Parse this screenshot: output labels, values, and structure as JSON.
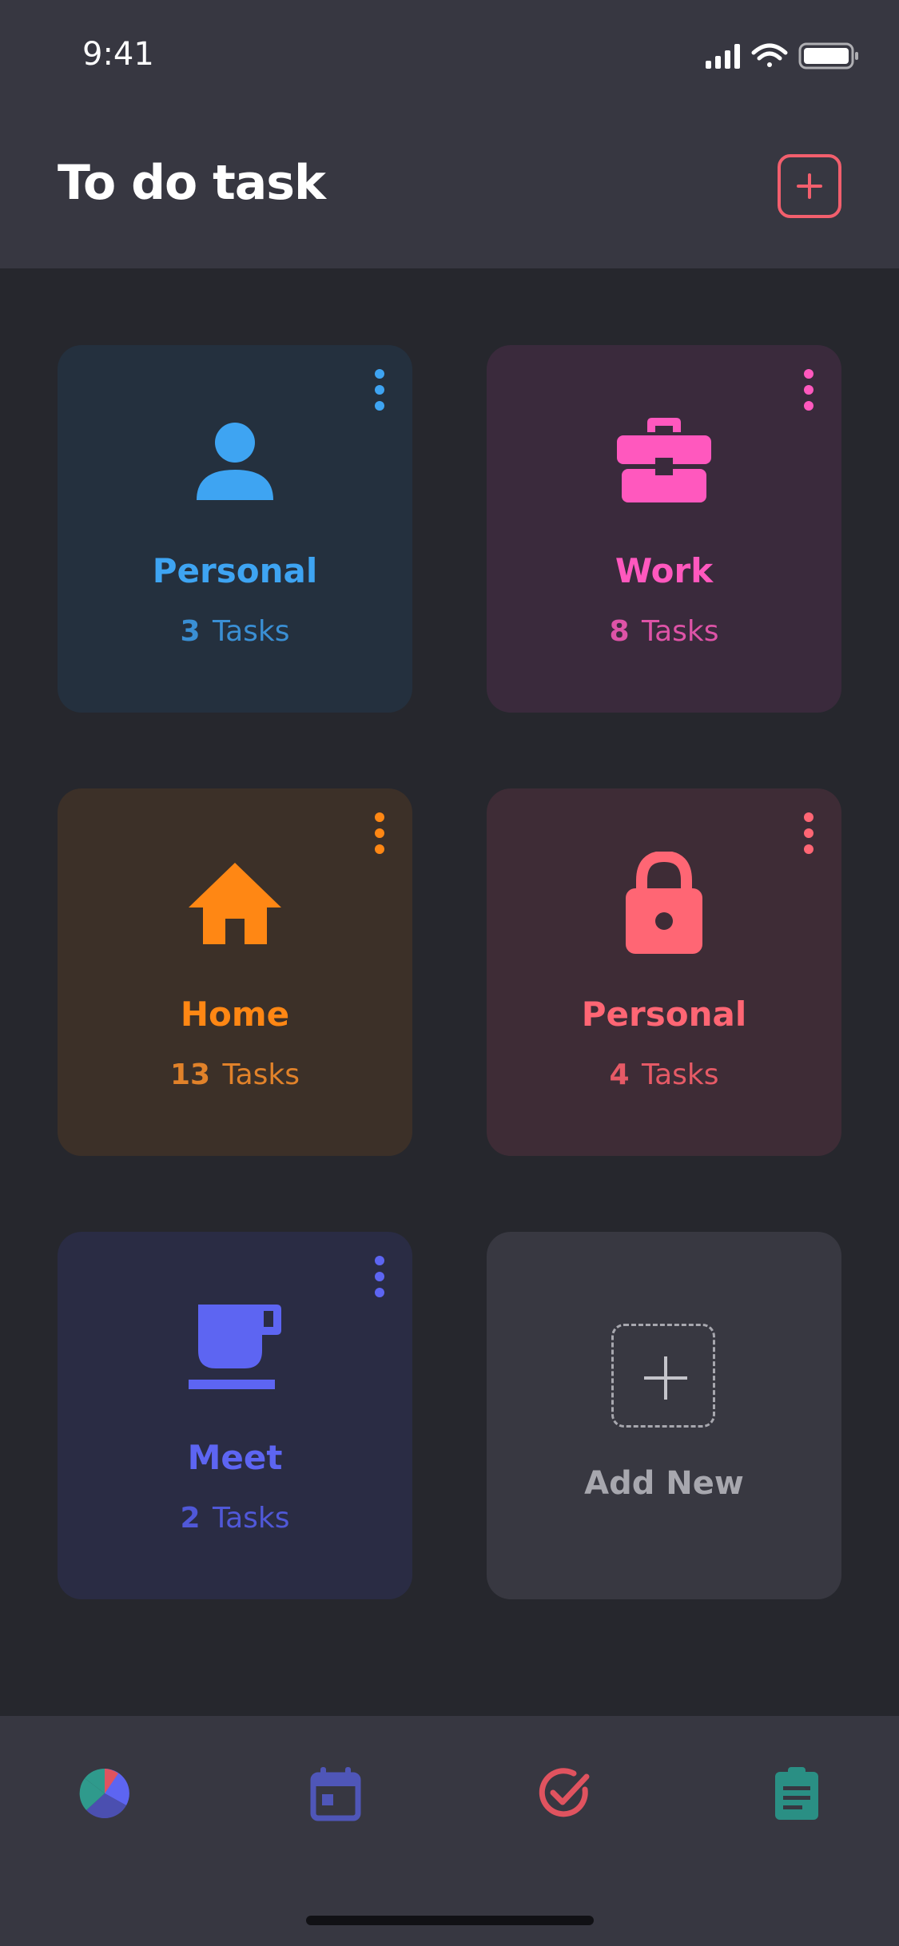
{
  "status_bar": {
    "time": "9:41"
  },
  "header": {
    "title": "To do task"
  },
  "cards": [
    {
      "label": "Personal",
      "count": "3",
      "unit": "Tasks",
      "icon": "person-icon",
      "color": "#3ea4f2"
    },
    {
      "label": "Work",
      "count": "8",
      "unit": "Tasks",
      "icon": "briefcase-icon",
      "color": "#ff58be"
    },
    {
      "label": "Home",
      "count": "13",
      "unit": "Tasks",
      "icon": "home-icon",
      "color": "#ff8714"
    },
    {
      "label": "Personal",
      "count": "4",
      "unit": "Tasks",
      "icon": "lock-icon",
      "color": "#ff6674"
    },
    {
      "label": "Meet",
      "count": "2",
      "unit": "Tasks",
      "icon": "coffee-cup-icon",
      "color": "#5d65f2"
    }
  ],
  "add_new": {
    "label": "Add New"
  },
  "tabbar": {
    "items": [
      {
        "icon": "pie-chart-icon"
      },
      {
        "icon": "calendar-icon"
      },
      {
        "icon": "check-circle-icon"
      },
      {
        "icon": "clipboard-icon"
      }
    ]
  },
  "colors": {
    "accent": "#f25f6d",
    "background": "#26272d",
    "header": "#373741"
  }
}
